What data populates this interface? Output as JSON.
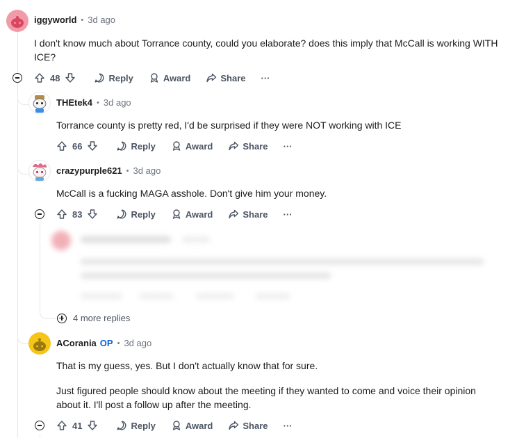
{
  "comments": [
    {
      "author": "iggyworld",
      "op_badge": "",
      "time": "3d ago",
      "body": [
        "I don't know much about Torrance county, could you elaborate? does this imply that McCall is working WITH ICE?"
      ],
      "votes": "48"
    },
    {
      "author": "THEtek4",
      "op_badge": "",
      "time": "3d ago",
      "body": [
        "Torrance county is pretty red, I'd be surprised if they were NOT working with ICE"
      ],
      "votes": "66"
    },
    {
      "author": "crazypurple621",
      "op_badge": "",
      "time": "3d ago",
      "body": [
        "McCall is a fucking MAGA asshole. Don't give him your money."
      ],
      "votes": "83"
    },
    {
      "author": "ACorania",
      "op_badge": "OP",
      "time": "3d ago",
      "body": [
        "That is my guess, yes. But I don't actually know that for sure.",
        "Just figured people should know about the meeting if they wanted to come and voice their opinion about it. I'll post a follow up after the meeting."
      ],
      "votes": "41"
    }
  ],
  "actions": {
    "reply": "Reply",
    "award": "Award",
    "share": "Share",
    "more": "···"
  },
  "more_replies": "4 more replies",
  "dot": "•",
  "colors": {
    "op": "#0a5fd8",
    "line": "#e5e7eb",
    "text": "#1c1c1c",
    "muted": "#6b7280"
  }
}
